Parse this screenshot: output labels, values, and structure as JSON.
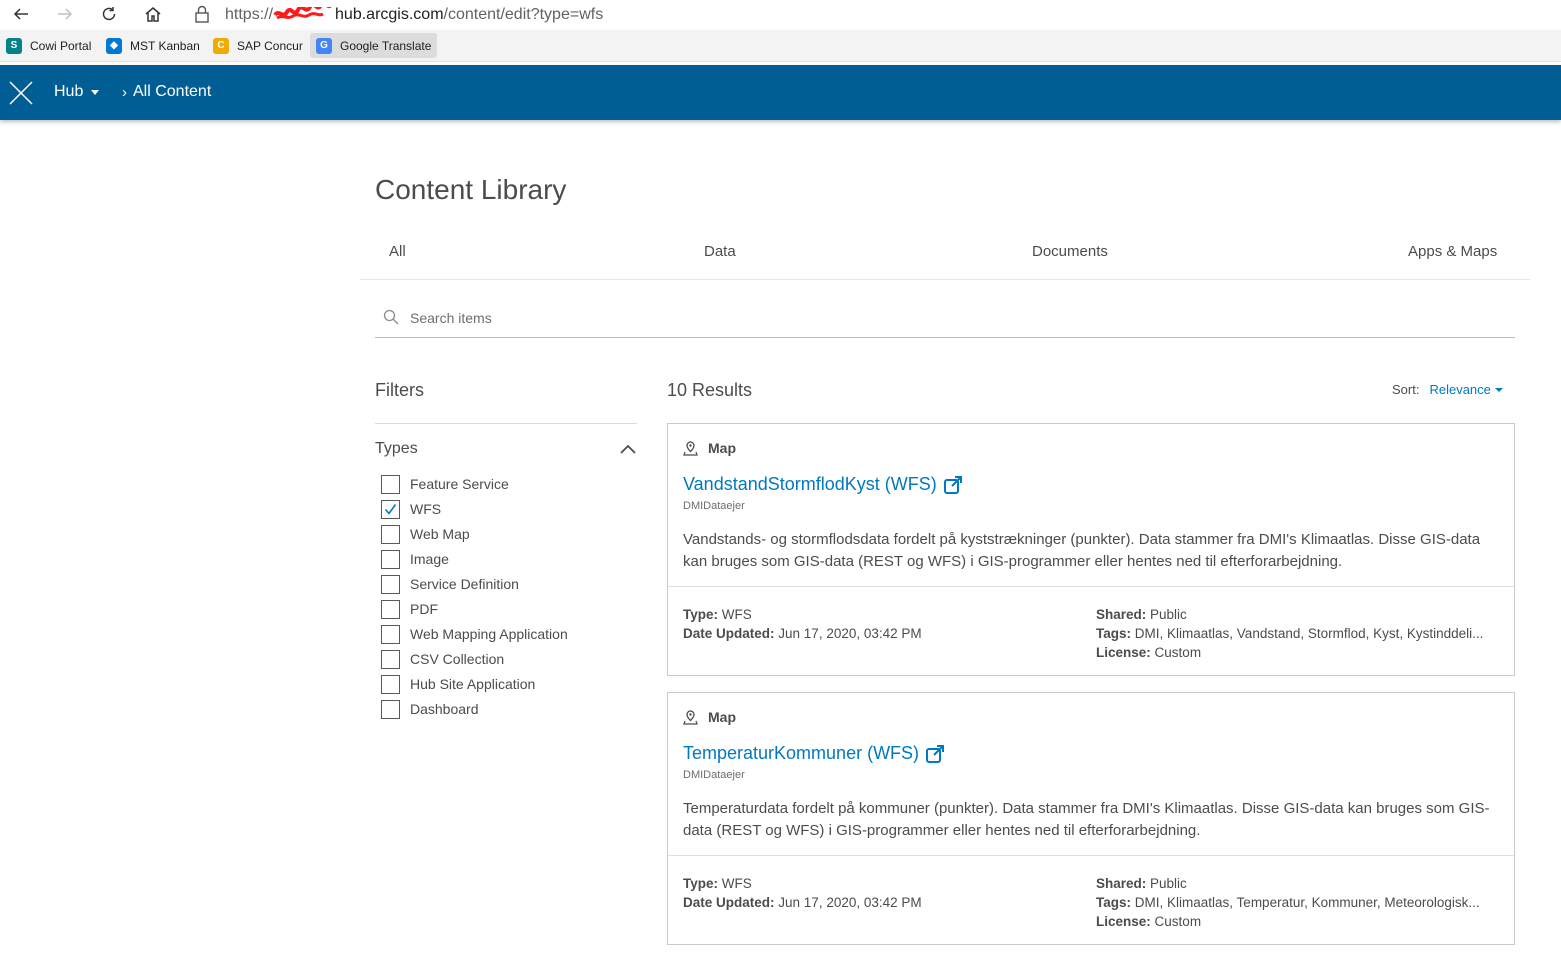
{
  "browser": {
    "url_prefix": "https://",
    "url_host": "hub.arcgis.com",
    "url_path": "/content/edit?type=wfs",
    "bookmarks": [
      {
        "label": "Cowi Portal",
        "icon": "sharepoint-icon",
        "color": "#038387"
      },
      {
        "label": "MST Kanban",
        "icon": "azure-devops-icon",
        "color": "#0078d4"
      },
      {
        "label": "SAP Concur",
        "icon": "concur-icon",
        "color": "#f0ab00"
      },
      {
        "label": "Google Translate",
        "icon": "google-translate-icon",
        "color": "#4285f4"
      }
    ]
  },
  "header": {
    "background": "#005e95",
    "hub_label": "Hub",
    "breadcrumb": "All Content"
  },
  "page": {
    "title": "Content Library",
    "tabs": [
      "All",
      "Data",
      "Documents",
      "Apps & Maps"
    ],
    "search_placeholder": "Search items"
  },
  "filters": {
    "title": "Filters",
    "group_title": "Types",
    "items": [
      {
        "label": "Feature Service",
        "checked": false
      },
      {
        "label": "WFS",
        "checked": true
      },
      {
        "label": "Web Map",
        "checked": false
      },
      {
        "label": "Image",
        "checked": false
      },
      {
        "label": "Service Definition",
        "checked": false
      },
      {
        "label": "PDF",
        "checked": false
      },
      {
        "label": "Web Mapping Application",
        "checked": false
      },
      {
        "label": "CSV Collection",
        "checked": false
      },
      {
        "label": "Hub Site Application",
        "checked": false
      },
      {
        "label": "Dashboard",
        "checked": false
      }
    ]
  },
  "results": {
    "count_label": "10 Results",
    "sort_label": "Sort:",
    "sort_value": "Relevance",
    "accent": "#0079c1",
    "items": [
      {
        "type_label": "Map",
        "title": "VandstandStormflodKyst (WFS)",
        "owner": "DMIDataejer",
        "description": "Vandstands- og stormflodsdata fordelt på kyststrækninger (punkter). Data stammer fra DMI's Klimaatlas. Disse GIS-data kan bruges som GIS-data (REST og WFS) i GIS-programmer eller hentes ned til efterforarbejdning.",
        "type_key": "Type:",
        "type_value": "WFS",
        "date_key": "Date Updated:",
        "date_value": "Jun 17, 2020, 03:42 PM",
        "shared_key": "Shared:",
        "shared_value": "Public",
        "tags_key": "Tags:",
        "tags_value": "DMI, Klimaatlas, Vandstand, Stormflod, Kyst, Kystinddeli...",
        "license_key": "License:",
        "license_value": "Custom"
      },
      {
        "type_label": "Map",
        "title": "TemperaturKommuner (WFS)",
        "owner": "DMIDataejer",
        "description": "Temperaturdata fordelt på kommuner (punkter). Data stammer fra DMI's Klimaatlas. Disse GIS-data kan bruges som GIS-data (REST og WFS) i GIS-programmer eller hentes ned til efterforarbejdning.",
        "type_key": "Type:",
        "type_value": "WFS",
        "date_key": "Date Updated:",
        "date_value": "Jun 17, 2020, 03:42 PM",
        "shared_key": "Shared:",
        "shared_value": "Public",
        "tags_key": "Tags:",
        "tags_value": "DMI, Klimaatlas, Temperatur, Kommuner, Meteorologisk...",
        "license_key": "License:",
        "license_value": "Custom"
      }
    ]
  }
}
